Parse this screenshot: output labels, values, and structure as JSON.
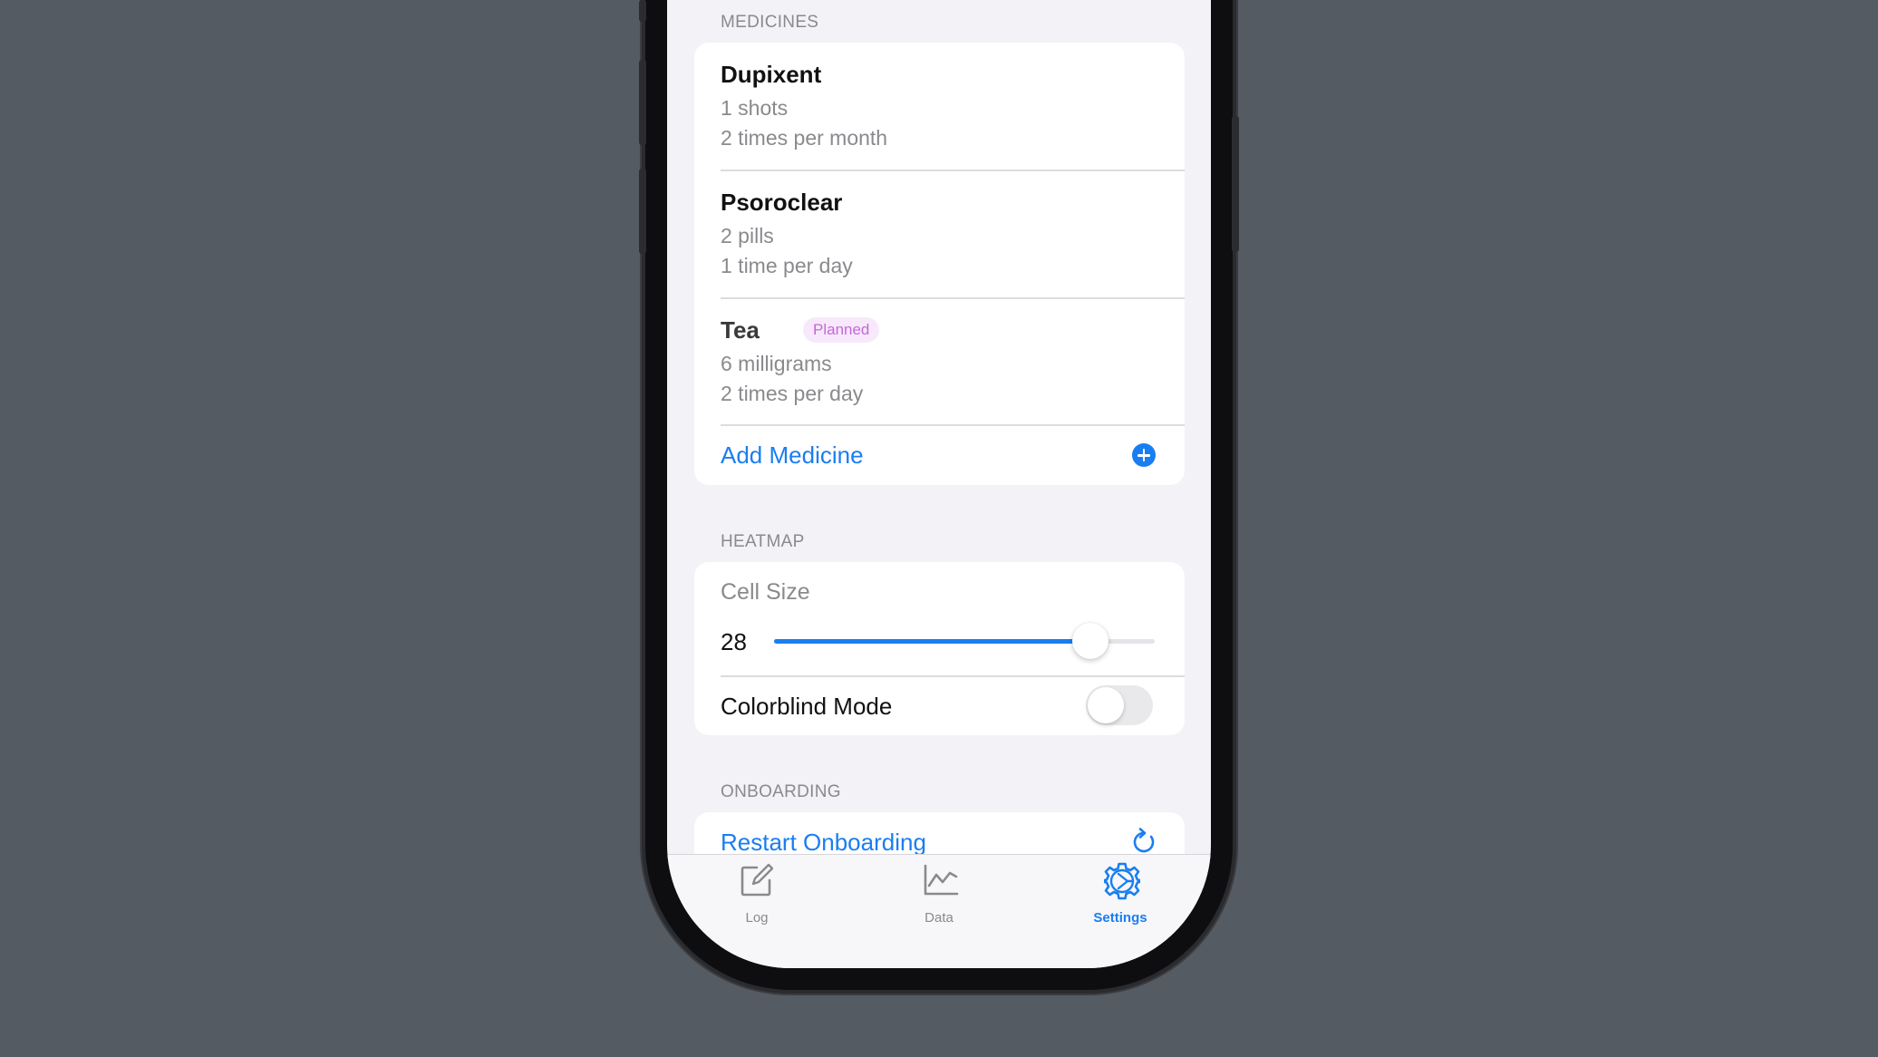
{
  "medicines": {
    "header": "MEDICINES",
    "items": [
      {
        "name": "Dupixent",
        "dose": "1 shots",
        "frequency": "2 times per month",
        "badge": null
      },
      {
        "name": "Psoroclear",
        "dose": "2 pills",
        "frequency": "1 time per day",
        "badge": null
      },
      {
        "name": "Tea",
        "dose": "6 milligrams",
        "frequency": "2 times per day",
        "badge": "Planned"
      }
    ],
    "add_label": "Add Medicine"
  },
  "heatmap": {
    "header": "HEATMAP",
    "cell_size_label": "Cell Size",
    "cell_size_value": "28",
    "slider_fraction": 0.83,
    "colorblind_label": "Colorblind Mode",
    "colorblind_on": false
  },
  "onboarding": {
    "header": "ONBOARDING",
    "restart_label": "Restart Onboarding"
  },
  "tabs": [
    {
      "label": "Log",
      "icon": "compose-icon",
      "active": false
    },
    {
      "label": "Data",
      "icon": "chart-line-icon",
      "active": false
    },
    {
      "label": "Settings",
      "icon": "gear-icon",
      "active": true
    }
  ],
  "colors": {
    "accent": "#1a7ef0",
    "badge_text": "#c468d8",
    "badge_bg": "#f7e9fb"
  }
}
